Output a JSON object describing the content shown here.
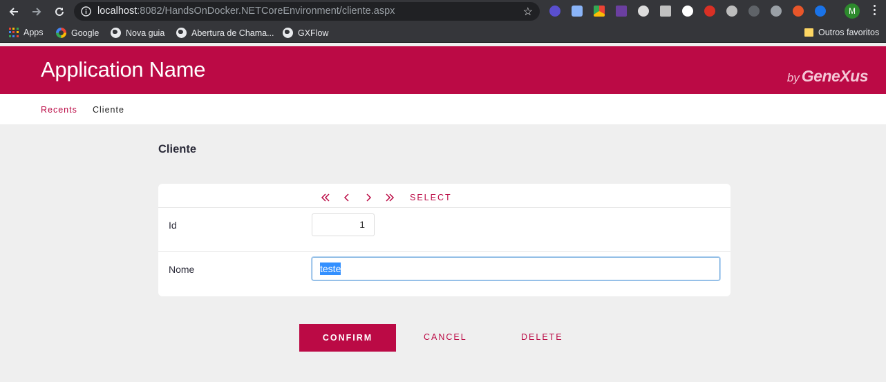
{
  "browser": {
    "url_host": "localhost",
    "url_rest": ":8082/HandsOnDocker.NETCoreEnvironment/cliente.aspx",
    "avatar_initial": "M",
    "bookmarks": [
      {
        "label": "Apps",
        "icon": "apps-grid-icon"
      },
      {
        "label": "Google",
        "icon": "google-icon"
      },
      {
        "label": "Nova guia",
        "icon": "globe-icon"
      },
      {
        "label": "Abertura de Chama...",
        "icon": "globe-icon"
      },
      {
        "label": "GXFlow",
        "icon": "globe-icon"
      }
    ],
    "other_bookmarks": "Outros favoritos"
  },
  "header": {
    "app_title": "Application Name",
    "brand_by": "by",
    "brand_name": "GeneXus",
    "accent_color": "#bb0a45"
  },
  "breadcrumb": {
    "recents": "Recents",
    "current": "Cliente"
  },
  "page": {
    "title": "Cliente"
  },
  "form": {
    "select_label": "SELECT",
    "pager_icons": [
      "first-page-icon",
      "previous-icon",
      "next-icon",
      "last-page-icon"
    ],
    "fields": {
      "id_label": "Id",
      "id_value": "1",
      "nome_label": "Nome",
      "nome_value": "teste"
    }
  },
  "actions": {
    "confirm": "CONFIRM",
    "cancel": "CANCEL",
    "delete": "DELETE"
  }
}
